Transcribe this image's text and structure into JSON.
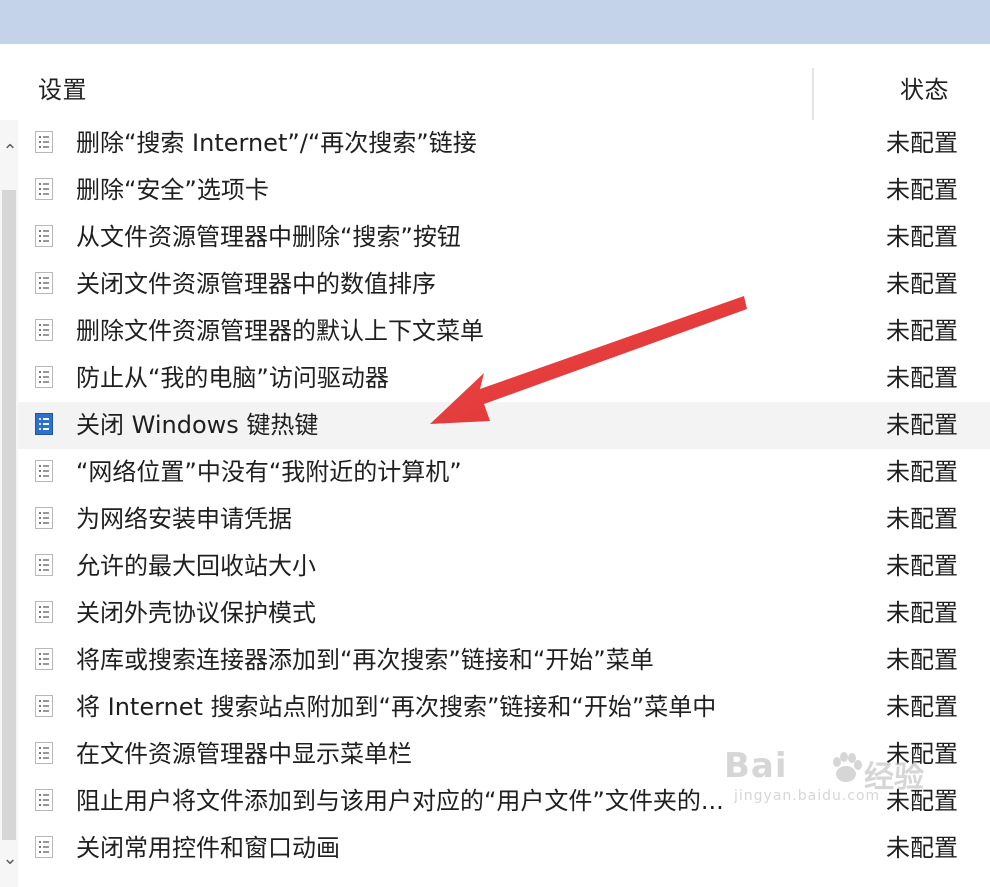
{
  "table": {
    "headers": {
      "setting": "设置",
      "status": "状态"
    },
    "rows": [
      {
        "setting": "删除“搜索 Internet”/“再次搜索”链接",
        "status": "未配置"
      },
      {
        "setting": "删除“安全”选项卡",
        "status": "未配置"
      },
      {
        "setting": "从文件资源管理器中删除“搜索”按钮",
        "status": "未配置"
      },
      {
        "setting": "关闭文件资源管理器中的数值排序",
        "status": "未配置"
      },
      {
        "setting": "删除文件资源管理器的默认上下文菜单",
        "status": "未配置"
      },
      {
        "setting": "防止从“我的电脑”访问驱动器",
        "status": "未配置"
      },
      {
        "setting": "关闭 Windows 键热键",
        "status": "未配置"
      },
      {
        "setting": "“网络位置”中没有“我附近的计算机”",
        "status": "未配置"
      },
      {
        "setting": "为网络安装申请凭据",
        "status": "未配置"
      },
      {
        "setting": "允许的最大回收站大小",
        "status": "未配置"
      },
      {
        "setting": "关闭外壳协议保护模式",
        "status": "未配置"
      },
      {
        "setting": "将库或搜索连接器添加到“再次搜索”链接和“开始”菜单",
        "status": "未配置"
      },
      {
        "setting": "将 Internet 搜索站点附加到“再次搜索”链接和“开始”菜单中",
        "status": "未配置"
      },
      {
        "setting": "在文件资源管理器中显示菜单栏",
        "status": "未配置"
      },
      {
        "setting": "阻止用户将文件添加到与该用户对应的“用户文件”文件夹的...",
        "status": "未配置"
      },
      {
        "setting": "关闭常用控件和窗口动画",
        "status": "未配置"
      }
    ]
  },
  "watermark": {
    "brand": "Bai",
    "suffix": "经验",
    "domain": "jingyan.baidu.com"
  },
  "icons": {
    "row_icon": "policy-list-icon",
    "scroll_up": "chevron-up-icon",
    "scroll_down": "chevron-down-icon",
    "arrow": "red-annotation-arrow"
  },
  "colors": {
    "top_band": "#c5d3ea",
    "highlight_row": "#f3f3f3",
    "selected_icon": "#2d72c8",
    "arrow": "#e53935"
  }
}
